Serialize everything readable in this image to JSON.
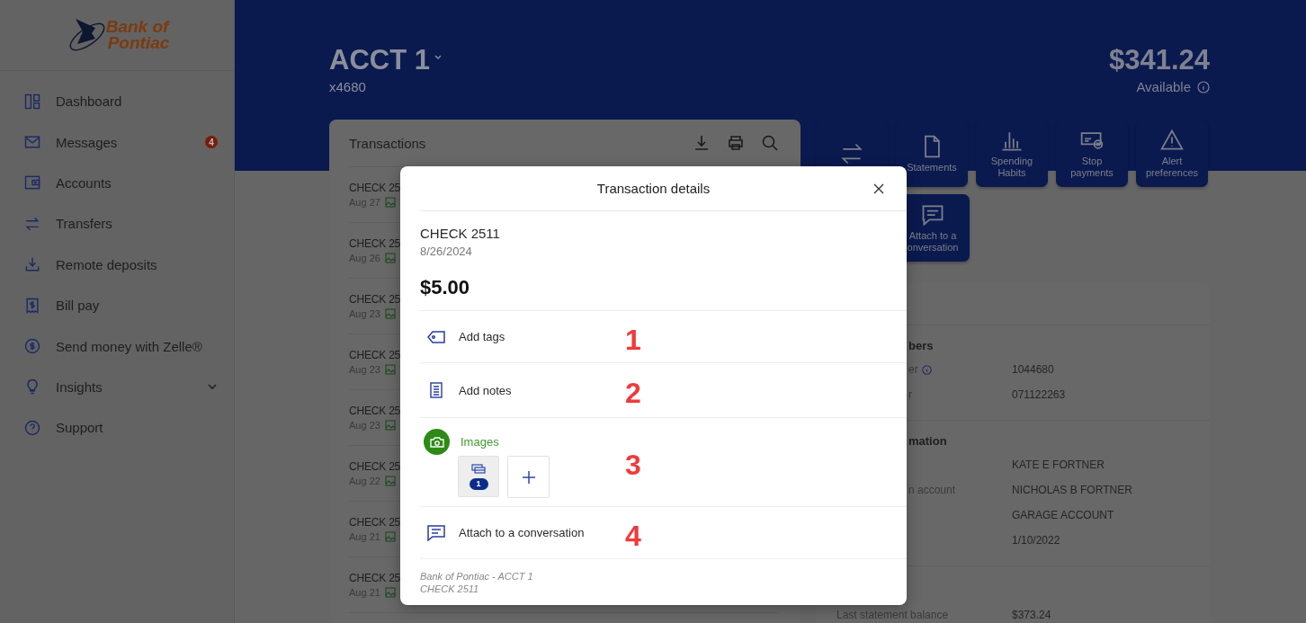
{
  "sidebar": {
    "logo": {
      "line_1": "Bank of",
      "line_2": "Pontiac"
    },
    "items": [
      {
        "label": "Dashboard"
      },
      {
        "label": "Messages",
        "badge": "4"
      },
      {
        "label": "Accounts"
      },
      {
        "label": "Transfers"
      },
      {
        "label": "Remote deposits"
      },
      {
        "label": "Bill pay"
      },
      {
        "label": "Send money with Zelle®"
      },
      {
        "label": "Insights",
        "expanded": false
      },
      {
        "label": "Support"
      }
    ]
  },
  "account": {
    "name": "ACCT 1",
    "number": "x4680",
    "balance": "$341.24",
    "balance_label": "Available"
  },
  "transactions": {
    "title": "Transactions",
    "rows": [
      {
        "description": "CHECK 25",
        "date": "Aug 27",
        "has_image": true
      },
      {
        "description": "CHECK 25",
        "date": "Aug 26",
        "has_image": true
      },
      {
        "description": "CHECK 25",
        "date": "Aug 23",
        "has_image": true
      },
      {
        "description": "CHECK 25",
        "date": "Aug 23",
        "has_image": true
      },
      {
        "description": "CHECK 25",
        "date": "Aug 23",
        "has_image": true
      },
      {
        "description": "CHECK 25",
        "date": "Aug 22",
        "has_image": true
      },
      {
        "description": "CHECK 25",
        "date": "Aug 21",
        "has_image": true
      },
      {
        "description": "CHECK 25",
        "date": "Aug 21",
        "has_image": true
      }
    ]
  },
  "actions": [
    {
      "kind": "transfer"
    },
    {
      "kind": "statements",
      "label_lines": [
        "Statements"
      ]
    },
    {
      "kind": "spending",
      "label_lines": [
        "Spending",
        "Habits"
      ]
    },
    {
      "kind": "stop",
      "label_lines": [
        "Stop",
        "payments"
      ]
    },
    {
      "kind": "alert",
      "label_lines": [
        "Alert",
        "preferences"
      ]
    },
    {
      "kind": "conversation",
      "label_lines": [
        "Attach to a",
        "onversation"
      ]
    }
  ],
  "account_info": {
    "sections": [
      {
        "heading": "bers",
        "rows": [
          {
            "label": "er",
            "info": true,
            "value": "1044680"
          },
          {
            "label": "r",
            "value": "071122263"
          }
        ]
      },
      {
        "heading": "mation",
        "rows": [
          {
            "value": "KATE E FORTNER"
          },
          {
            "label": "n account",
            "value": "NICHOLAS B FORTNER"
          },
          {
            "value": "GARAGE ACCOUNT"
          },
          {
            "value": "1/10/2022"
          }
        ]
      },
      {
        "rows": [
          {
            "label": "Last statement balance",
            "value": "$373.24"
          }
        ]
      }
    ]
  },
  "modal": {
    "title": "Transaction details",
    "description": "CHECK 2511",
    "date": "8/26/2024",
    "amount": "$5.00",
    "options": [
      {
        "kind": "tags",
        "label": "Add tags",
        "annotation": "1"
      },
      {
        "kind": "notes",
        "label": "Add notes",
        "annotation": "2"
      },
      {
        "kind": "images",
        "label": "Images",
        "image_count": "1",
        "annotation": "3"
      },
      {
        "kind": "conversation",
        "label": "Attach to a conversation",
        "annotation": "4"
      }
    ],
    "footer_lines": [
      "Bank of Pontiac - ACCT 1",
      "CHECK 2511"
    ]
  }
}
